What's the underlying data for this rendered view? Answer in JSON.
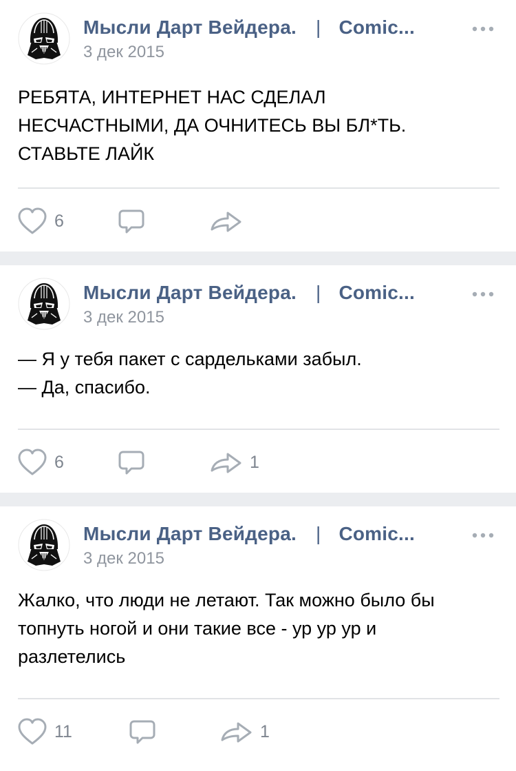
{
  "colors": {
    "author": "#4a6185",
    "meta": "#8f959e",
    "icon": "#a6adb5",
    "separator_band": "#ebedf0"
  },
  "posts": [
    {
      "author": "Мысли Дарт Вейдера.",
      "separator": "|",
      "source": "Comic...",
      "date": "3 дек 2015",
      "text": "РЕБЯТА, ИНТЕРНЕТ НАС СДЕЛАЛ\nНЕСЧАСТНЫМИ, ДА ОЧНИТЕСЬ ВЫ БЛ*ТЬ.\nСТАВЬТЕ ЛАЙК",
      "likes": "6",
      "comments": "",
      "shares": ""
    },
    {
      "author": "Мысли Дарт Вейдера.",
      "separator": "|",
      "source": "Comic...",
      "date": "3 дек 2015",
      "text": "— Я у тебя пакет с сардельками забыл.\n— Да, спасибо.",
      "likes": "6",
      "comments": "",
      "shares": "1"
    },
    {
      "author": "Мысли Дарт Вейдера.",
      "separator": "|",
      "source": "Comic...",
      "date": "3 дек 2015",
      "text": "Жалко, что люди не летают. Так можно было бы\nтопнуть ногой и они такие все - ур ур ур и\nразлетелись",
      "likes": "11",
      "comments": "",
      "shares": "1"
    }
  ],
  "icons": {
    "avatar": "darth-vader-helmet",
    "more": "more-dots",
    "like": "heart-outline",
    "comment": "speech-bubble-outline",
    "share": "share-arrow-outline"
  }
}
